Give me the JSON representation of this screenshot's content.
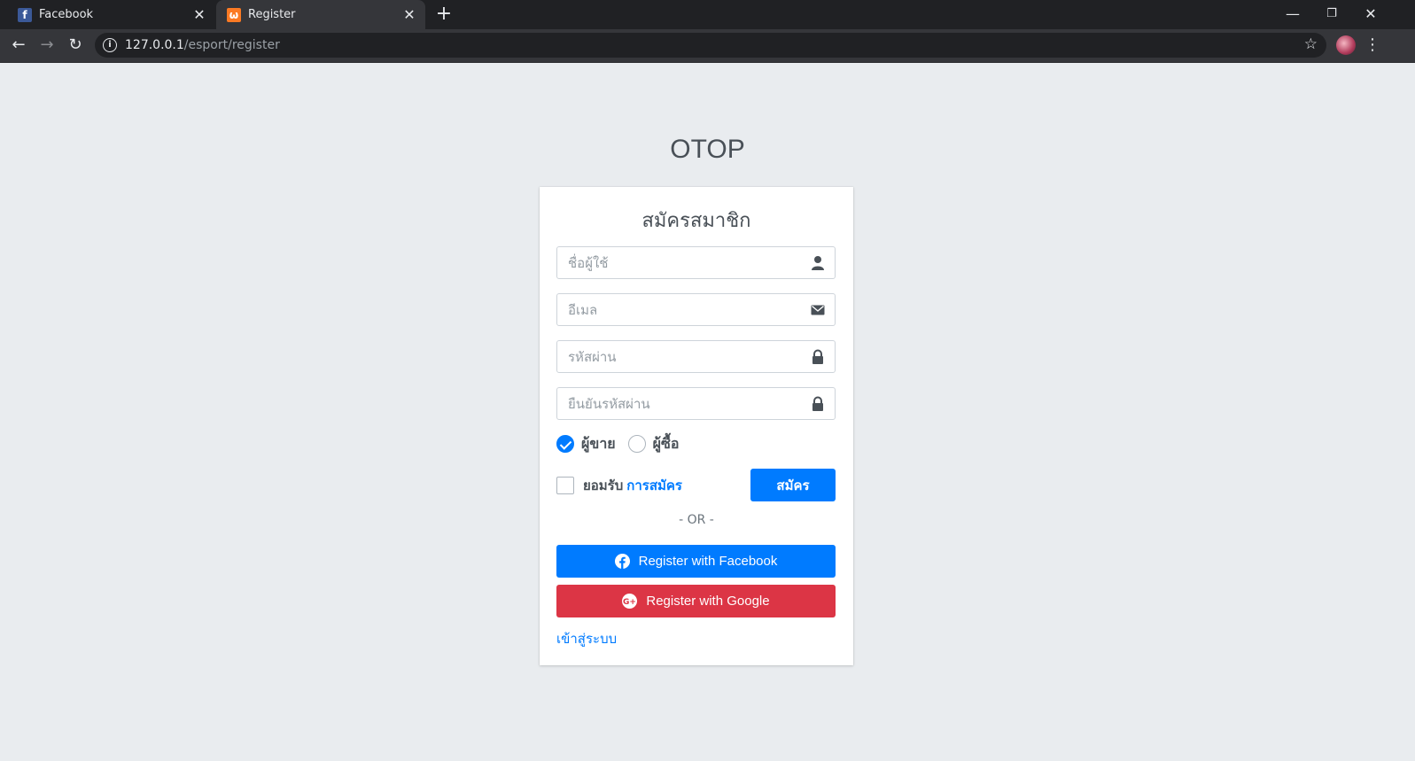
{
  "browser": {
    "tabs": [
      {
        "title": "Facebook",
        "icon": "facebook-icon"
      },
      {
        "title": "Register",
        "icon": "xampp-icon"
      }
    ],
    "url_host": "127.0.0.1",
    "url_path": "/esport/register"
  },
  "page": {
    "brand": "OTOP",
    "card_title": "สมัครสมาชิก",
    "fields": {
      "username_placeholder": "ชื่อผู้ใช้",
      "email_placeholder": "อีเมล",
      "password_placeholder": "รหัสผ่าน",
      "confirm_placeholder": "ยืนยันรหัสผ่าน"
    },
    "roles": {
      "seller_label": "ผู้ขาย",
      "buyer_label": "ผู้ซื้อ",
      "selected": "seller"
    },
    "agree_text": "ยอมรับ",
    "agree_link": "การสมัคร",
    "submit_label": "สมัคร",
    "or_text": "- OR -",
    "facebook_button": "Register with Facebook",
    "google_button": "Register with Google",
    "login_link": "เข้าสู่ระบบ"
  },
  "colors": {
    "primary": "#007bff",
    "danger": "#dc3545",
    "background": "#e9ecef"
  }
}
